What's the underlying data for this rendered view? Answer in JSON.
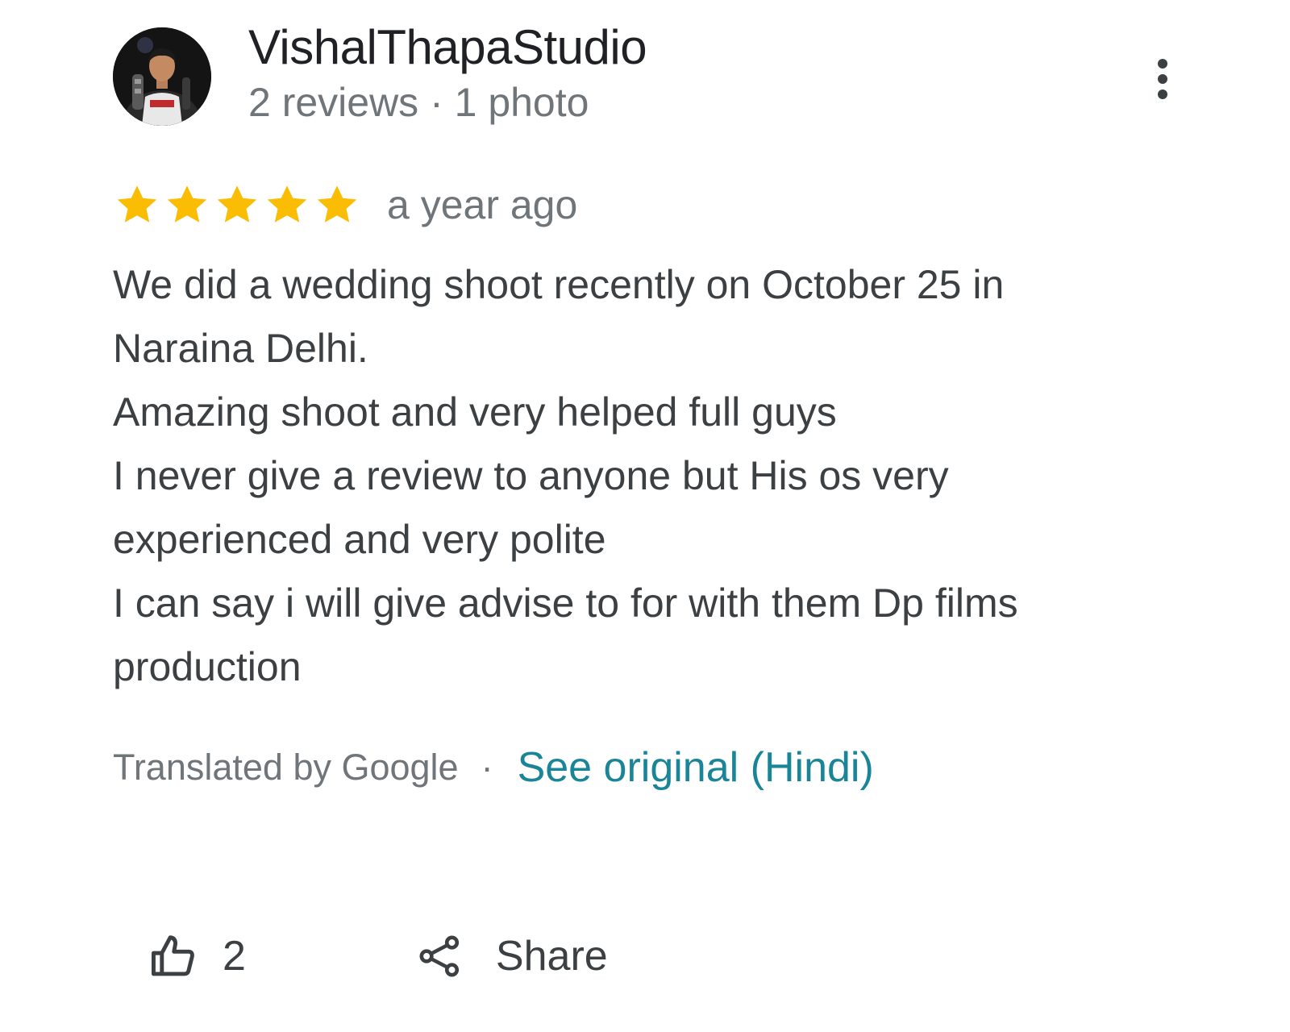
{
  "review": {
    "author": {
      "name": "VishalThapaStudio",
      "meta": "2 reviews · 1 photo",
      "avatar_icon": "profile-photo"
    },
    "more_icon": "more-vert-icon",
    "rating": {
      "stars": 5,
      "max": 5,
      "star_color": "#fbbc04",
      "time": "a year ago"
    },
    "text_lines": [
      "We did a wedding shoot recently on October 25 in",
      "Naraina Delhi.",
      "Amazing shoot and very helped full guys",
      "I never give a review to anyone but His os very",
      "experienced and very polite",
      "I can say i will give advise to for with them Dp films",
      "production"
    ],
    "translation": {
      "label": "Translated by Google",
      "separator": "·",
      "link_label": "See original (Hindi)",
      "link_color": "#1a8598"
    },
    "actions": {
      "like_icon": "thumbs-up-icon",
      "like_count": "2",
      "share_icon": "share-icon",
      "share_label": "Share"
    }
  }
}
